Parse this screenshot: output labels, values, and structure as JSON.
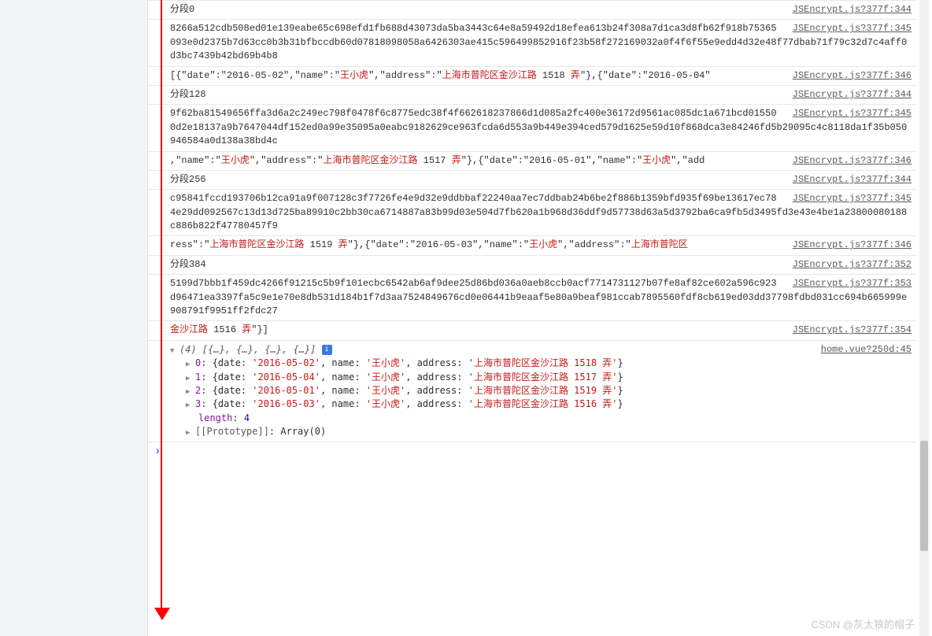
{
  "entries": [
    {
      "text": "分段0",
      "src": "JSEncrypt.js?377f:344"
    },
    {
      "text": "8266a512cdb508ed01e139eabe65c698efd1fb688d43073da5ba3443c64e8a59492d18efea613b24f308a7d1ca3d8fb62f918b75365093e0d2375b7d63cc0b3b31bfbccdb60d07818098058a6426303ae415c596499852916f23b58f272169032a0f4f6f55e9edd4d32e48f77dbab71f79c32d7c4aff0d3bc7439b42bd69b4b8",
      "src": "JSEncrypt.js?377f:345"
    },
    {
      "html": "[{\"date\":\"2016-05-02\",\"name\":\"<span class='str'>王小虎</span>\",\"address\":\"<span class='str'>上海市普陀区金沙江路</span> 1518 <span class='str'>弄</span>\"},{\"date\":\"2016-05-04\"",
      "src": "JSEncrypt.js?377f:346"
    },
    {
      "text": "分段128",
      "src": "JSEncrypt.js?377f:344"
    },
    {
      "text": "9f62ba81549656ffa3d6a2c249ec798f0478f6c8775edc38f4f662618237866d1d085a2fc400e36172d9561ac085dc1a671bcd015500d2e18137a9b7647044df152ed0a99e35095a0eabc9182629ce963fcda6d553a9b449e394ced579d1625e59d10f868dca3e84246fd5b29095c4c8118da1f35b050946584a0d138a38bd4c",
      "src": "JSEncrypt.js?377f:345"
    },
    {
      "html": ",\"name\":\"<span class='str'>王小虎</span>\",\"address\":\"<span class='str'>上海市普陀区金沙江路</span> 1517 <span class='str'>弄</span>\"},{\"date\":\"2016-05-01\",\"name\":\"<span class='str'>王小虎</span>\",\"add",
      "src": "JSEncrypt.js?377f:346"
    },
    {
      "text": "分段256",
      "src": "JSEncrypt.js?377f:344"
    },
    {
      "text": "c95841fccd193706b12ca91a9f007128c3f7726fe4e9d32e9ddbbaf22240aa7ec7ddbab24b6be2f886b1359bfd935f69be13617ec784e29dd092567c13d13d725ba89910c2bb30ca6714887a83b99d03e504d7fb620a1b968d36ddf9d57738d63a5d3792ba6ca9fb5d3495fd3e43e4be1a23800080188c886b822f47780457f9",
      "src": "JSEncrypt.js?377f:345"
    },
    {
      "html": "ress\":\"<span class='str'>上海市普陀区金沙江路</span> 1519 <span class='str'>弄</span>\"},{\"date\":\"2016-05-03\",\"name\":\"<span class='str'>王小虎</span>\",\"address\":\"<span class='str'>上海市普陀区</span>",
      "src": "JSEncrypt.js?377f:346"
    },
    {
      "text": "分段384",
      "src": "JSEncrypt.js?377f:352"
    },
    {
      "text": "5199d7bbb1f459dc4266f91215c5b9f101ecbc6542ab6af9dee25d86bd036a0aeb8ccb0acf7714731127b07fe8af82ce602a596c923d96471ea3397fa5c9e1e70e8db531d184b1f7d3aa7524849676cd0e06441b9eaaf5e80a9beaf981ccab7895560fdf8cb619ed03dd37798fdbd031cc694b665999e908791f9951ff2fdc27",
      "src": "JSEncrypt.js?377f:353"
    },
    {
      "html": "<span class='str'>金沙江路</span> 1516 <span class='str'>弄</span>\"}]",
      "src": "JSEncrypt.js?377f:354"
    }
  ],
  "array_src": "home.vue?250d:45",
  "array_count": 4,
  "array_summary": "(4) [{…}, {…}, {…}, {…}]",
  "array_items": [
    {
      "idx": "0",
      "date": "2016-05-02",
      "name": "王小虎",
      "address": "上海市普陀区金沙江路 1518 弄"
    },
    {
      "idx": "1",
      "date": "2016-05-04",
      "name": "王小虎",
      "address": "上海市普陀区金沙江路 1517 弄"
    },
    {
      "idx": "2",
      "date": "2016-05-01",
      "name": "王小虎",
      "address": "上海市普陀区金沙江路 1519 弄"
    },
    {
      "idx": "3",
      "date": "2016-05-03",
      "name": "王小虎",
      "address": "上海市普陀区金沙江路 1516 弄"
    }
  ],
  "length_label": "length",
  "length_value": "4",
  "proto_label": "[[Prototype]]",
  "proto_value": "Array(0)",
  "watermark": "CSDN @灰太狼的帽子"
}
